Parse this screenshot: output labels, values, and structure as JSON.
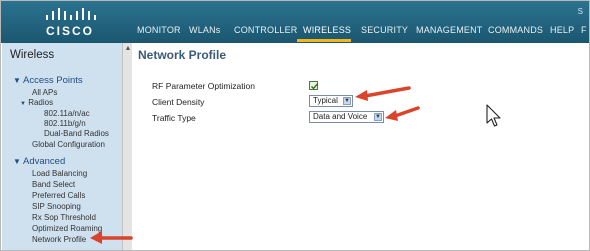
{
  "header": {
    "logo_text": "CISCO",
    "corner_text": "S",
    "nav": [
      {
        "label": "MONITOR"
      },
      {
        "label": "WLANs"
      },
      {
        "label": "CONTROLLER"
      },
      {
        "label": "WIRELESS"
      },
      {
        "label": "SECURITY"
      },
      {
        "label": "MANAGEMENT"
      },
      {
        "label": "COMMANDS"
      },
      {
        "label": "HELP"
      },
      {
        "label": "F"
      }
    ],
    "active_nav": "WIRELESS"
  },
  "sidebar": {
    "title": "Wireless",
    "access_points": {
      "heading": "Access Points",
      "all_aps": "All APs",
      "radios": "Radios",
      "radio_items": [
        "802.11a/n/ac",
        "802.11b/g/n",
        "Dual-Band Radios"
      ],
      "global_config": "Global Configuration"
    },
    "advanced": {
      "heading": "Advanced",
      "items": [
        "Load Balancing",
        "Band Select",
        "Preferred Calls",
        "SIP Snooping",
        "Rx Sop Threshold",
        "Optimized Roaming",
        "Network Profile"
      ]
    }
  },
  "main": {
    "title": "Network Profile",
    "rf_label": "RF Parameter Optimization",
    "rf_checked": true,
    "density_label": "Client Density",
    "density_value": "Typical",
    "traffic_label": "Traffic Type",
    "traffic_value": "Data and Voice"
  },
  "colors": {
    "header": "#1f5f7a",
    "sidebar": "#cfe0ee",
    "active_underline": "#f4b41a",
    "annotation_arrow": "#d9442b"
  }
}
